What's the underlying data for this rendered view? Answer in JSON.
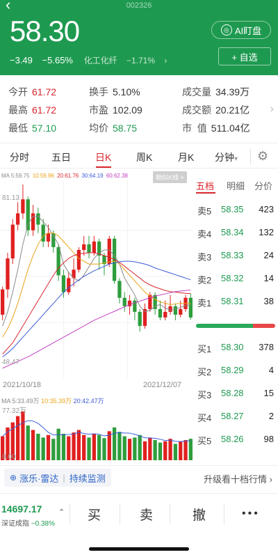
{
  "header": {
    "back_icon": "chevron-left-icon",
    "stock_code": "002326",
    "price": "58.30",
    "change": "−3.49",
    "change_pct": "−5.65%",
    "sector": "化工化纤",
    "sector_pct": "−1.71%",
    "sector_arrow": "›",
    "ai_label": "AI盯盘",
    "fav_label": "+ 自选",
    "color": "#1e9a50"
  },
  "stats": {
    "open_label": "今开",
    "open": "61.72",
    "high_label": "最高",
    "high": "61.72",
    "low_label": "最低",
    "low": "57.10",
    "turnover_label": "换手",
    "turnover": "5.10%",
    "pe_label": "市盈",
    "pe": "102.09",
    "avg_label": "均价",
    "avg": "58.75",
    "volume_label": "成交量",
    "volume": "34.39万",
    "amount_label": "成交额",
    "amount": "20.21亿",
    "mcap_label": "市  值",
    "mcap": "511.04亿"
  },
  "tabs": [
    "分时",
    "五日",
    "日K",
    "周K",
    "月K",
    "分钟"
  ],
  "tab_active": "日K",
  "tab_dropdown_icon": "▾",
  "chart": {
    "ma_legend": [
      "MA 5:59.75",
      "10:59.96",
      "20:61.76",
      "30:64.19",
      "60:62.38"
    ],
    "ma_colors": [
      "#888888",
      "#e8a317",
      "#d8262d",
      "#3a5bd9",
      "#c040c0"
    ],
    "similar_btn": "相似K线 >",
    "price_high_label": "81.13",
    "price_low_label": "48.47",
    "date_start": "2021/10/18",
    "date_end": "2021/12/07",
    "vol_legend": [
      "MA 5:33.49万",
      "10:35.39万",
      "20:42.47万"
    ],
    "vol_colors": [
      "#888888",
      "#e8a317",
      "#3a5bd9"
    ],
    "vol_max_label": "77.32万",
    "vol_zero_label": "0.00",
    "up_color": "#e02020",
    "down_color": "#2e9d3c"
  },
  "chart_data": {
    "type": "candlestick",
    "ylim": [
      48.47,
      81.13
    ],
    "candles": [
      {
        "o": 58.0,
        "c": 62.5,
        "h": 63.0,
        "l": 57.0
      },
      {
        "o": 62.5,
        "c": 68.0,
        "h": 69.0,
        "l": 61.0
      },
      {
        "o": 68.0,
        "c": 74.0,
        "h": 75.0,
        "l": 67.0
      },
      {
        "o": 74.0,
        "c": 76.0,
        "h": 78.0,
        "l": 73.0
      },
      {
        "o": 76.0,
        "c": 78.5,
        "h": 81.13,
        "l": 75.0
      },
      {
        "o": 78.5,
        "c": 73.0,
        "h": 79.0,
        "l": 72.0
      },
      {
        "o": 73.0,
        "c": 76.0,
        "h": 77.5,
        "l": 72.0
      },
      {
        "o": 76.0,
        "c": 74.0,
        "h": 77.0,
        "l": 72.5
      },
      {
        "o": 74.0,
        "c": 71.0,
        "h": 75.0,
        "l": 70.0
      },
      {
        "o": 71.0,
        "c": 72.5,
        "h": 74.0,
        "l": 70.0
      },
      {
        "o": 72.5,
        "c": 70.0,
        "h": 73.0,
        "l": 69.0
      },
      {
        "o": 70.0,
        "c": 65.0,
        "h": 70.5,
        "l": 64.0
      },
      {
        "o": 65.0,
        "c": 62.0,
        "h": 66.0,
        "l": 61.0
      },
      {
        "o": 62.0,
        "c": 64.5,
        "h": 65.5,
        "l": 61.5
      },
      {
        "o": 64.5,
        "c": 66.0,
        "h": 68.0,
        "l": 63.0
      },
      {
        "o": 66.0,
        "c": 69.5,
        "h": 70.0,
        "l": 65.5
      },
      {
        "o": 69.5,
        "c": 70.5,
        "h": 72.0,
        "l": 68.5
      },
      {
        "o": 70.5,
        "c": 69.0,
        "h": 72.0,
        "l": 68.0
      },
      {
        "o": 69.0,
        "c": 71.0,
        "h": 72.0,
        "l": 68.5
      },
      {
        "o": 71.0,
        "c": 68.5,
        "h": 71.5,
        "l": 66.0
      },
      {
        "o": 68.5,
        "c": 67.0,
        "h": 69.0,
        "l": 65.0
      },
      {
        "o": 67.0,
        "c": 71.5,
        "h": 72.0,
        "l": 66.5
      },
      {
        "o": 71.5,
        "c": 64.0,
        "h": 72.0,
        "l": 63.5
      },
      {
        "o": 64.0,
        "c": 61.0,
        "h": 64.5,
        "l": 60.0
      },
      {
        "o": 61.0,
        "c": 59.5,
        "h": 62.0,
        "l": 58.5
      },
      {
        "o": 59.5,
        "c": 60.5,
        "h": 61.5,
        "l": 58.0
      },
      {
        "o": 60.5,
        "c": 58.5,
        "h": 61.0,
        "l": 57.0
      },
      {
        "o": 58.5,
        "c": 56.0,
        "h": 59.0,
        "l": 55.0
      },
      {
        "o": 56.0,
        "c": 59.0,
        "h": 60.0,
        "l": 55.5
      },
      {
        "o": 59.0,
        "c": 61.5,
        "h": 62.0,
        "l": 58.5
      },
      {
        "o": 61.5,
        "c": 59.0,
        "h": 62.0,
        "l": 58.0
      },
      {
        "o": 59.0,
        "c": 57.5,
        "h": 60.5,
        "l": 57.0
      },
      {
        "o": 57.5,
        "c": 58.5,
        "h": 60.5,
        "l": 57.0
      },
      {
        "o": 58.5,
        "c": 59.5,
        "h": 61.5,
        "l": 58.0
      },
      {
        "o": 59.5,
        "c": 58.0,
        "h": 60.0,
        "l": 57.0
      },
      {
        "o": 58.0,
        "c": 59.0,
        "h": 60.5,
        "l": 57.5
      },
      {
        "o": 59.0,
        "c": 61.0,
        "h": 61.5,
        "l": 58.5
      },
      {
        "o": 61.0,
        "c": 57.5,
        "h": 61.72,
        "l": 57.1
      }
    ],
    "ma5": [
      56.0,
      58.5,
      62.0,
      66.0,
      70.5,
      74.0,
      75.5,
      75.5,
      74.5,
      73.5,
      72.0,
      70.5,
      67.0,
      65.5,
      64.5,
      64.0,
      65.0,
      66.5,
      68.0,
      69.0,
      69.5,
      69.5,
      68.5,
      67.0,
      64.5,
      63.0,
      61.5,
      59.5,
      58.5,
      58.8,
      59.5,
      59.8,
      59.2,
      58.8,
      59.0,
      59.3,
      59.6,
      59.75
    ],
    "ma10": [
      54.0,
      55.5,
      57.5,
      60.0,
      63.0,
      66.0,
      68.5,
      70.5,
      72.0,
      72.5,
      72.5,
      72.0,
      71.0,
      70.0,
      69.0,
      68.0,
      67.5,
      67.0,
      67.0,
      67.0,
      67.2,
      67.4,
      67.5,
      67.0,
      66.0,
      65.0,
      64.0,
      63.0,
      62.0,
      61.3,
      60.7,
      60.3,
      60.0,
      59.8,
      59.9,
      60.0,
      60.0,
      59.96
    ],
    "ma20": [
      51.0,
      52.0,
      53.0,
      54.5,
      56.0,
      57.5,
      59.0,
      60.5,
      62.0,
      63.5,
      65.0,
      66.3,
      67.2,
      68.0,
      68.5,
      68.8,
      68.9,
      69.0,
      69.0,
      68.8,
      68.5,
      68.2,
      67.8,
      67.3,
      66.6,
      65.9,
      65.2,
      64.5,
      63.8,
      63.3,
      62.9,
      62.6,
      62.3,
      62.1,
      62.0,
      61.9,
      61.8,
      61.76
    ],
    "ma30": [
      50.5,
      51.2,
      52.0,
      53.0,
      54.0,
      55.0,
      56.0,
      57.0,
      58.0,
      59.0,
      60.0,
      61.0,
      62.0,
      62.8,
      63.5,
      64.2,
      64.8,
      65.3,
      65.8,
      66.2,
      66.6,
      67.0,
      67.2,
      67.4,
      67.5,
      67.5,
      67.4,
      67.2,
      67.0,
      66.7,
      66.3,
      66.0,
      65.7,
      65.4,
      65.1,
      64.8,
      64.5,
      64.19
    ],
    "ma60": [
      48.47,
      48.9,
      49.3,
      49.7,
      50.1,
      50.5,
      51.0,
      51.5,
      52.0,
      52.5,
      53.0,
      53.5,
      54.0,
      54.5,
      55.0,
      55.5,
      56.0,
      56.5,
      57.0,
      57.4,
      57.8,
      58.2,
      58.6,
      59.0,
      59.4,
      59.8,
      60.1,
      60.4,
      60.7,
      61.0,
      61.3,
      61.5,
      61.7,
      61.9,
      62.1,
      62.2,
      62.3,
      62.38
    ],
    "volume_ylim": [
      0,
      77.32
    ],
    "volumes": [
      38,
      52,
      60,
      70,
      77.32,
      55,
      48,
      42,
      36,
      40,
      34,
      50,
      42,
      38,
      44,
      48,
      40,
      36,
      42,
      40,
      35,
      46,
      52,
      45,
      38,
      34,
      36,
      40,
      30,
      36,
      32,
      28,
      30,
      34,
      26,
      30,
      32,
      34
    ]
  },
  "book": {
    "tabs": [
      "五档",
      "明细",
      "分价"
    ],
    "asks": [
      {
        "label": "卖5",
        "price": "58.35",
        "qty": "423"
      },
      {
        "label": "卖4",
        "price": "58.34",
        "qty": "132"
      },
      {
        "label": "卖3",
        "price": "58.33",
        "qty": "24"
      },
      {
        "label": "卖2",
        "price": "58.32",
        "qty": "14"
      },
      {
        "label": "卖1",
        "price": "58.31",
        "qty": "38"
      }
    ],
    "bids": [
      {
        "label": "买1",
        "price": "58.30",
        "qty": "378"
      },
      {
        "label": "买2",
        "price": "58.29",
        "qty": "4"
      },
      {
        "label": "买3",
        "price": "58.28",
        "qty": "15"
      },
      {
        "label": "买4",
        "price": "58.27",
        "qty": "2"
      },
      {
        "label": "买5",
        "price": "58.26",
        "qty": "98"
      }
    ],
    "bid_ratio": 0.72,
    "bid_color": "#2aa95a",
    "ask_color": "#e84848"
  },
  "bottom": {
    "radar_icon": "plus-circle-icon",
    "radar_label": "涨乐·雷达",
    "monitor_label": "持续监测",
    "upgrade_label": "升级看十档行情",
    "upgrade_arrow": "›",
    "index_value": "14697.17",
    "index_name": "深证成指",
    "index_pct": "−0.38%",
    "expand_icon": "chevron-up-icon",
    "buy": "买",
    "sell": "卖",
    "cancel": "撤",
    "more_icon": "more-dots-icon"
  }
}
